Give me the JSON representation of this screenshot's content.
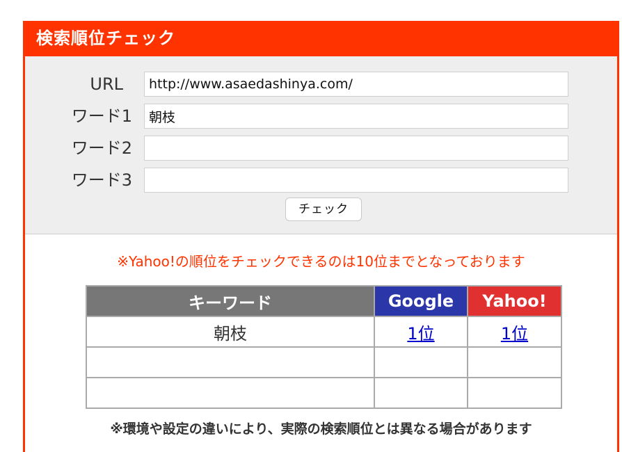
{
  "header": {
    "title": "検索順位チェック"
  },
  "form": {
    "url_label": "URL",
    "url_value": "http://www.asaedashinya.com/",
    "word1_label": "ワード1",
    "word1_value": "朝枝",
    "word2_label": "ワード2",
    "word2_value": "",
    "word3_label": "ワード3",
    "word3_value": "",
    "check_button_label": "チェック"
  },
  "notice": "※Yahoo!の順位をチェックできるのは10位までとなっております",
  "results": {
    "headers": {
      "keyword": "キーワード",
      "google": "Google",
      "yahoo": "Yahoo!"
    },
    "rows": [
      {
        "keyword": "朝枝",
        "google": "1位",
        "yahoo": "1位"
      },
      {
        "keyword": "",
        "google": "",
        "yahoo": ""
      },
      {
        "keyword": "",
        "google": "",
        "yahoo": ""
      }
    ]
  },
  "footnote": "※環境や設定の違いにより、実際の検索順位とは異なる場合があります",
  "colors": {
    "brand": "#ff3300",
    "google_header": "#2b36a8",
    "yahoo_header": "#e03030",
    "keyword_header": "#777777",
    "link": "#0000cc"
  }
}
